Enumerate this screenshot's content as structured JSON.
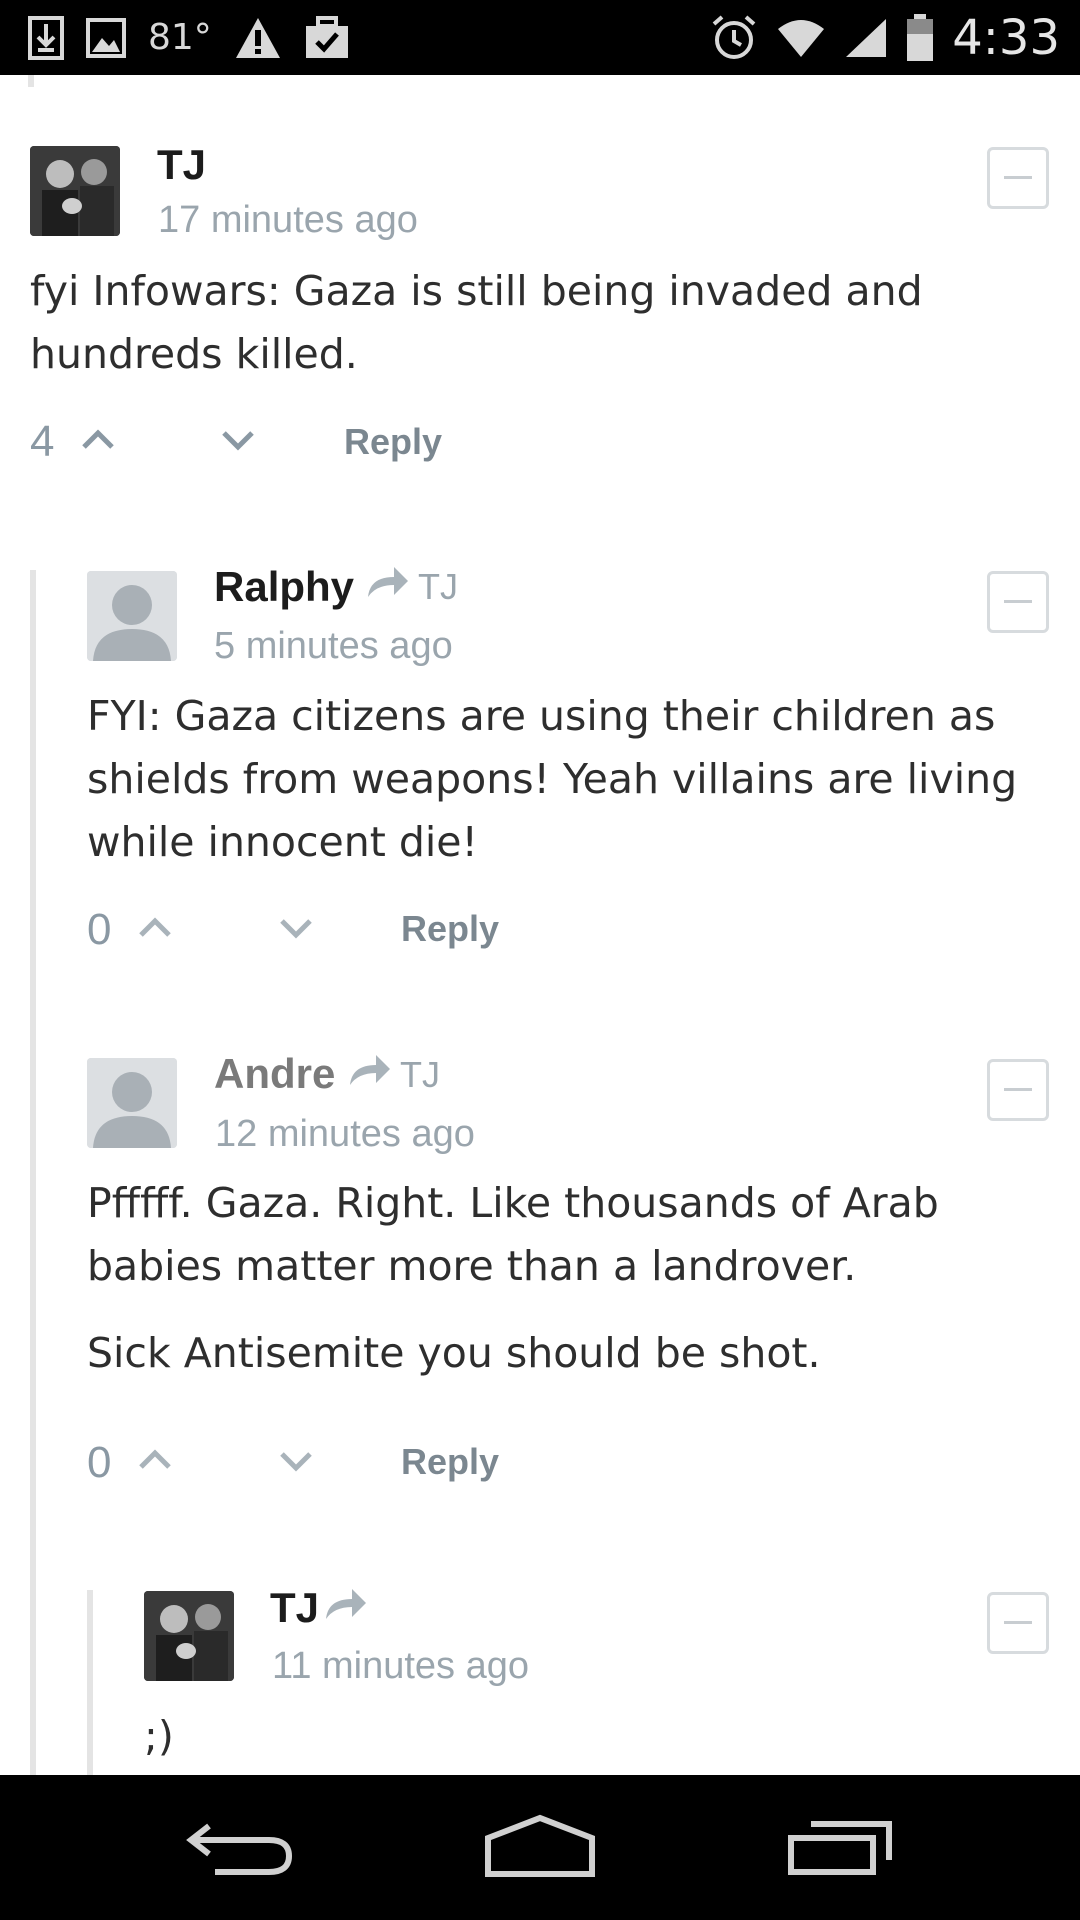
{
  "status_bar": {
    "temperature": "81°",
    "time": "4:33"
  },
  "comments": [
    {
      "author": "TJ",
      "time": "17 minutes ago",
      "body": "fyi Infowars: Gaza is still being invaded and\nhundreds killed.",
      "votes": "4",
      "reply_label": "Reply"
    },
    {
      "author": "Ralphy",
      "reply_to": "TJ",
      "time": "5 minutes ago",
      "body": "FYI: Gaza citizens are using their children as\nshields from weapons! Yeah villains are living\nwhile innocent die!",
      "votes": "0",
      "reply_label": "Reply"
    },
    {
      "author": "Andre",
      "reply_to": "TJ",
      "time": "12 minutes ago",
      "body": "Pfffff. Gaza. Right. Like thousands of Arab\nbabies matter more than a landrover.",
      "body2": "Sick Antisemite you should be shot.",
      "votes": "0",
      "reply_label": "Reply"
    },
    {
      "author": "TJ",
      "time": "11 minutes ago",
      "body": ";)"
    }
  ],
  "icons": {
    "download": "download-icon",
    "image": "image-icon",
    "warning": "warning-icon",
    "briefcase": "briefcase-check-icon",
    "alarm": "alarm-icon",
    "wifi": "wifi-icon",
    "signal": "signal-icon",
    "battery": "battery-icon",
    "back": "back-icon",
    "home": "home-icon",
    "recents": "recents-icon"
  },
  "colors": {
    "meta_grey": "#9aa5ad",
    "thread_line": "#e4e4e4"
  }
}
